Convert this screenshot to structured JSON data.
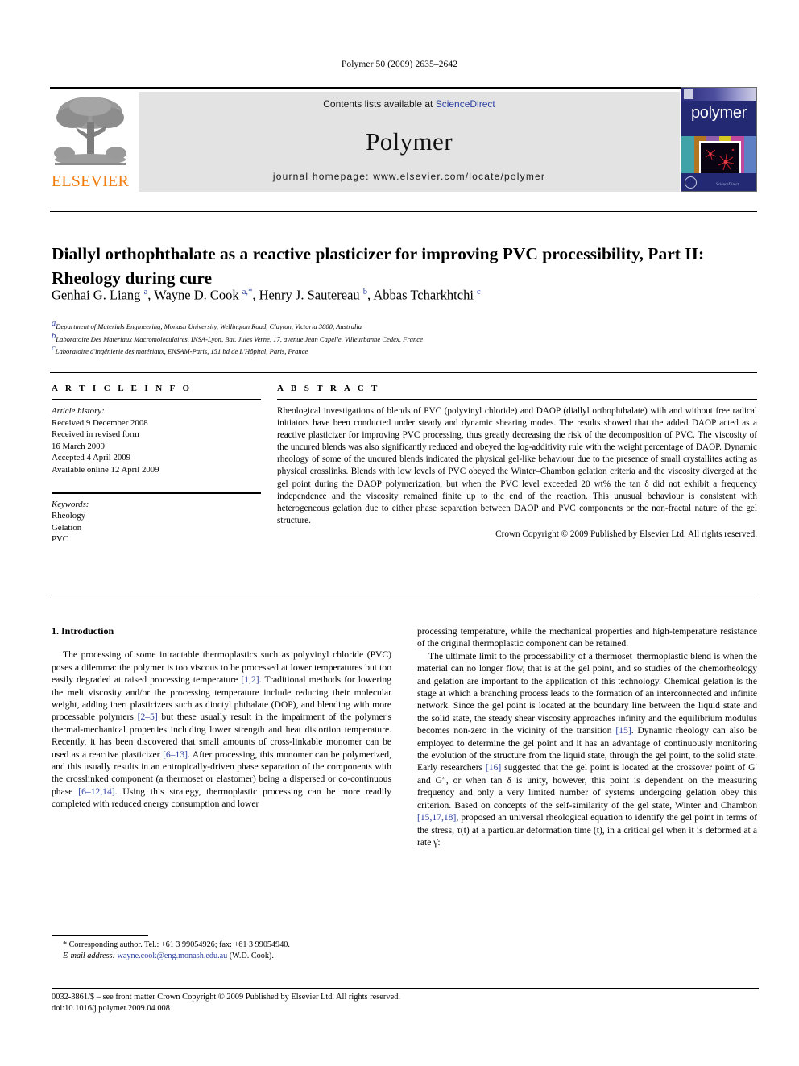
{
  "running_head": "Polymer 50 (2009) 2635–2642",
  "masthead": {
    "contents_prefix": "Contents lists available at",
    "sciencedirect": "ScienceDirect",
    "journal_name": "Polymer",
    "homepage": "journal homepage: www.elsevier.com/locate/polymer",
    "publisher_wordmark": "ELSEVIER",
    "cover_title": "polymer",
    "cover_footer": "ScienceDirect",
    "accent_link_color": "#2b3fa0",
    "elsevier_orange": "#F07D10",
    "cover_blue": "#232a73"
  },
  "article": {
    "title": "Diallyl orthophthalate as a reactive plasticizer for improving PVC processibility, Part II: Rheology during cure",
    "authors_html": "Genhai G. Liang <sup>a</sup>, Wayne D. Cook <sup>a,</sup><sup>*</sup>, Henry J. Sautereau <sup>b</sup>, Abbas Tcharkhtchi <sup>c</sup>",
    "affiliations": [
      "Department of Materials Engineering, Monash University, Wellington Road, Clayton, Victoria 3800, Australia",
      "Laboratoire Des Materiaux Macromoleculaires, INSA-Lyon, Bat. Jules Verne, 17, avenue Jean Capelle, Villeurbanne Cedex, France",
      "Laboratoire d'ingénierie des matériaux, ENSAM-Paris, 151 bd de L'Hôpital, Paris, France"
    ],
    "affiliation_marks": [
      "a",
      "b",
      "c"
    ]
  },
  "article_info": {
    "heading": "A R T I C L E  I N F O",
    "history_label": "Article history:",
    "history": [
      "Received 9 December 2008",
      "Received in revised form",
      "16 March 2009",
      "Accepted 4 April 2009",
      "Available online 12 April 2009"
    ],
    "keywords_label": "Keywords:",
    "keywords": [
      "Rheology",
      "Gelation",
      "PVC"
    ]
  },
  "abstract": {
    "heading": "A B S T R A C T",
    "body": "Rheological investigations of blends of PVC (polyvinyl chloride) and DAOP (diallyl orthophthalate) with and without free radical initiators have been conducted under steady and dynamic shearing modes. The results showed that the added DAOP acted as a reactive plasticizer for improving PVC processing, thus greatly decreasing the risk of the decomposition of PVC. The viscosity of the uncured blends was also significantly reduced and obeyed the log-additivity rule with the weight percentage of DAOP. Dynamic rheology of some of the uncured blends indicated the physical gel-like behaviour due to the presence of small crystallites acting as physical crosslinks. Blends with low levels of PVC obeyed the Winter–Chambon gelation criteria and the viscosity diverged at the gel point during the DAOP polymerization, but when the PVC level exceeded 20 wt% the tan δ did not exhibit a frequency independence and the viscosity remained finite up to the end of the reaction. This unusual behaviour is consistent with heterogeneous gelation due to either phase separation between DAOP and PVC components or the non-fractal nature of the gel structure.",
    "copyright": "Crown Copyright © 2009 Published by Elsevier Ltd. All rights reserved."
  },
  "body": {
    "section_number_title": "1.  Introduction",
    "left_paragraphs": [
      "The processing of some intractable thermoplastics such as polyvinyl chloride (PVC) poses a dilemma: the polymer is too viscous to be processed at lower temperatures but too easily degraded at raised processing temperature [1,2]. Traditional methods for lowering the melt viscosity and/or the processing temperature include reducing their molecular weight, adding inert plasticizers such as dioctyl phthalate (DOP), and blending with more processable polymers [2–5] but these usually result in the impairment of the polymer's thermal-mechanical properties including lower strength and heat distortion temperature. Recently, it has been discovered that small amounts of cross-linkable monomer can be used as a reactive plasticizer [6–13]. After processing, this monomer can be polymerized, and this usually results in an entropically-driven phase separation of the components with the crosslinked component (a thermoset or elastomer) being a dispersed or co-continuous phase [6–12,14]. Using this strategy, thermoplastic processing can be more readily completed with reduced energy consumption and lower"
    ],
    "right_paragraphs": [
      "processing temperature, while the mechanical properties and high-temperature resistance of the original thermoplastic component can be retained.",
      "The ultimate limit to the processability of a thermoset–thermoplastic blend is when the material can no longer flow, that is at the gel point, and so studies of the chemorheology and gelation are important to the application of this technology. Chemical gelation is the stage at which a branching process leads to the formation of an interconnected and infinite network. Since the gel point is located at the boundary line between the liquid state and the solid state, the steady shear viscosity approaches infinity and the equilibrium modulus becomes non-zero in the vicinity of the transition [15]. Dynamic rheology can also be employed to determine the gel point and it has an advantage of continuously monitoring the evolution of the structure from the liquid state, through the gel point, to the solid state. Early researchers [16] suggested that the gel point is located at the crossover point of G′ and G″, or when tan δ is unity, however, this point is dependent on the measuring frequency and only a very limited number of systems undergoing gelation obey this criterion. Based on concepts of the self-similarity of the gel state, Winter and Chambon [15,17,18], proposed an universal rheological equation to identify the gel point in terms of the stress, τ(t) at a particular deformation time (t), in a critical gel when it is deformed at a rate γ̇:"
    ]
  },
  "footnotes": {
    "corresponding": "* Corresponding author. Tel.: +61 3 99054926; fax: +61 3 99054940.",
    "email_label": "E-mail address:",
    "email": "wayne.cook@eng.monash.edu.au",
    "email_suffix": "(W.D. Cook)."
  },
  "footer": {
    "issn_line": "0032-3861/$ – see front matter Crown Copyright © 2009 Published by Elsevier Ltd. All rights reserved.",
    "doi_line": "doi:10.1016/j.polymer.2009.04.008"
  }
}
